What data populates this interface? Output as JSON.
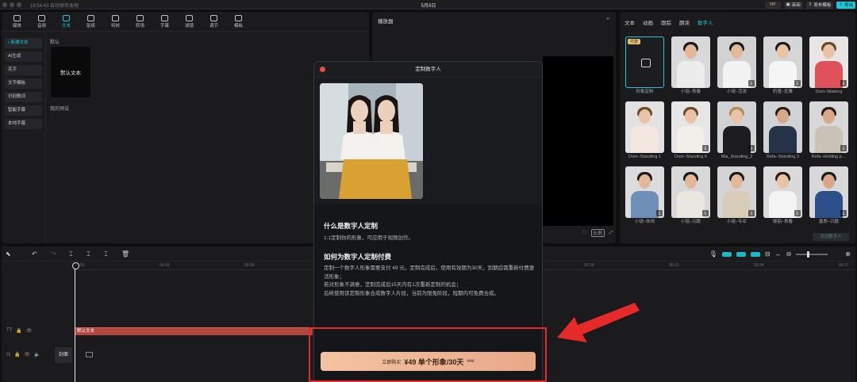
{
  "titlebar": {
    "autosave": "16:54:43 自动保存本地",
    "title": "5月6日",
    "vip": "VIP",
    "review": "审阅",
    "publish": "发布模板",
    "export": "导出"
  },
  "tools": [
    {
      "label": "媒体",
      "active": false
    },
    {
      "label": "音频",
      "active": false
    },
    {
      "label": "文本",
      "active": true
    },
    {
      "label": "贴纸",
      "active": false
    },
    {
      "label": "特效",
      "active": false
    },
    {
      "label": "转场",
      "active": false
    },
    {
      "label": "字幕",
      "active": false
    },
    {
      "label": "滤镜",
      "active": false
    },
    {
      "label": "调节",
      "active": false
    },
    {
      "label": "模板",
      "active": false
    }
  ],
  "text_menu": [
    "• 新建文本",
    "AI生成",
    "花字",
    "文字模板",
    "识别歌词",
    "智能字幕",
    "本地字幕"
  ],
  "text_panel": {
    "default_label": "默认",
    "default_tile": "默认文本",
    "my_presets": "我的预设"
  },
  "player": {
    "title": "播放器",
    "ratio": "比例"
  },
  "right_tabs": [
    {
      "label": "文本",
      "active": false
    },
    {
      "label": "动画",
      "active": false
    },
    {
      "label": "跟踪",
      "active": false
    },
    {
      "label": "朗读",
      "active": false
    },
    {
      "label": "数字人",
      "active": true
    }
  ],
  "avatars": [
    {
      "name": "形象定制",
      "badge": "付费",
      "custom": true
    },
    {
      "name": "小铭–青春",
      "skin": "#e2b89a",
      "hair": "#1a1a1a",
      "body": "#ececec",
      "bg": "#d9d9d9"
    },
    {
      "name": "小锐–活泼",
      "skin": "#e2b89a",
      "hair": "#1a1a1a",
      "body": "#f2f2f2",
      "bg": "#d2d2d2",
      "download": true
    },
    {
      "name": "奶童–优雅",
      "skin": "#e9c3a6",
      "hair": "#1a1a1a",
      "body": "#f5f5f5",
      "bg": "#d6d6d6",
      "download": true
    },
    {
      "name": "Dom–Walking",
      "skin": "#e9c3a6",
      "hair": "#6b4a2a",
      "body": "#e0515c",
      "bg": "#e8e6e4",
      "download": true
    },
    {
      "name": "Dom–Standing 1",
      "skin": "#e9c3a6",
      "hair": "#6b4a2a",
      "body": "#f2e8df",
      "bg": "#e2e2e2"
    },
    {
      "name": "Dom–Standing 6",
      "skin": "#e9c3a6",
      "hair": "#6b4a2a",
      "body": "#f0efe9",
      "bg": "#e6e6e6",
      "download": true
    },
    {
      "name": "Mia_Standing_2",
      "skin": "#e9c3a6",
      "hair": "#b58a5a",
      "body": "#1d1d1f",
      "bg": "#d0d2d4",
      "download": true
    },
    {
      "name": "Refa–Standing 3",
      "skin": "#d7a98a",
      "hair": "#2a1d14",
      "body": "#253247",
      "bg": "#cfd3d6"
    },
    {
      "name": "Refa–Holding p…",
      "skin": "#d7a98a",
      "hair": "#2a1d14",
      "body": "#c9c2b7",
      "bg": "#d8d8d8",
      "download": true
    },
    {
      "name": "小锐–休闲",
      "skin": "#e2b89a",
      "hair": "#1a1a1a",
      "body": "#6f8fb6",
      "bg": "#dcdcdc",
      "download": true
    },
    {
      "name": "小铭–沉稳",
      "skin": "#e2b89a",
      "hair": "#1a1a1a",
      "body": "#e9e7e2",
      "bg": "#d8d8d8",
      "download": true
    },
    {
      "name": "小锐–专业",
      "skin": "#e2b89a",
      "hair": "#1a1a1a",
      "body": "#d8cdb9",
      "bg": "#d4d4d4",
      "download": true
    },
    {
      "name": "婉丽–青春",
      "skin": "#e9c3a6",
      "hair": "#2a1d14",
      "body": "#f3f3f3",
      "bg": "#dadada",
      "download": true
    },
    {
      "name": "鑫郎–沉稳",
      "skin": "#d7a98a",
      "hair": "#1a1a1a",
      "body": "#2d4f8a",
      "bg": "#d8d8d8",
      "download": true
    }
  ],
  "add_digital_human": "添加数字人",
  "timeline": {
    "ticks": [
      "00:00",
      "00:03",
      "00:06",
      "00:09",
      "00:12",
      "00:15",
      "00:18",
      "00:21",
      "00:24",
      "00:27"
    ],
    "text_clip": "默认文本",
    "cover": "封面"
  },
  "modal": {
    "title": "定制数字人",
    "heading1": "什么是数字人定制",
    "para1": "1:1定制你的形象，可应用于视频创作。",
    "heading2": "如何为数字人定制付费",
    "body_lines": [
      "定制一个数字人形象需要支付 49 元，定制完成后，使用有效期为30天，到期后需重新付费激活形象；",
      "若对形象不满意，定制完成后15天内有1次重新定制的机会；",
      "后续使用该定制形象合成数字人片段，当前为限免阶段，短期内可免费合成。"
    ],
    "buy_label": "立即购买",
    "buy_price": "¥49 单个形象/30天",
    "buy_original": "¥99"
  },
  "colors": {
    "accent": "#20c5d3",
    "annotation": "#e62a2a",
    "buy_button": "#f0b898"
  }
}
